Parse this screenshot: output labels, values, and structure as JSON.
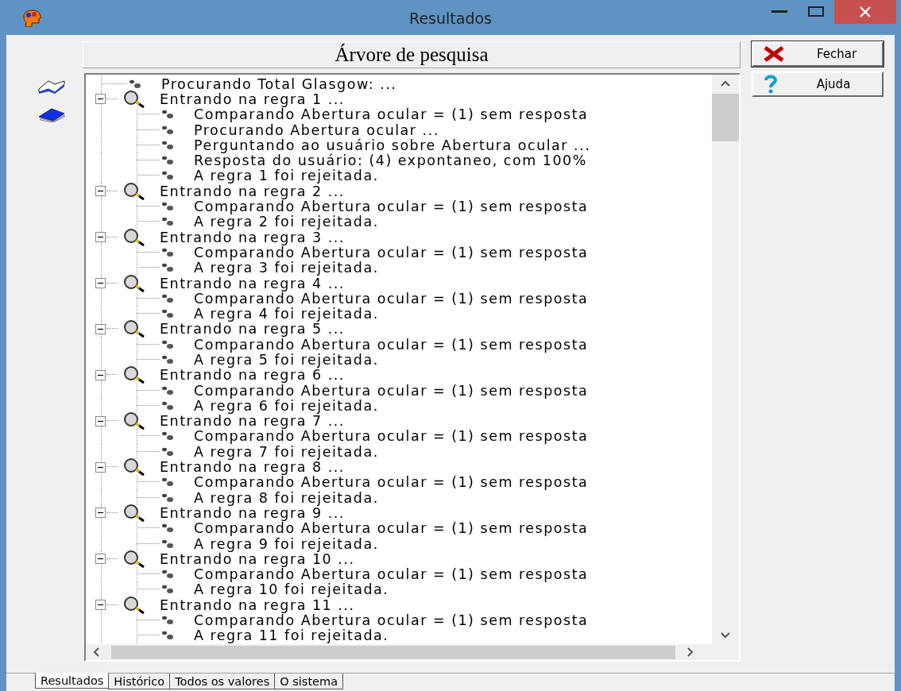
{
  "window": {
    "title": "Resultados"
  },
  "header": "Árvore de pesquisa",
  "buttons": [
    {
      "kind": "close",
      "label": "Fechar"
    },
    {
      "kind": "help",
      "label": "Ajuda"
    }
  ],
  "tree": [
    {
      "kind": "step",
      "label": "Procurando Total Glasgow: ..."
    },
    {
      "kind": "rule",
      "label": "Entrando na regra 1 ...",
      "expanded": true,
      "children": [
        {
          "label": "Comparando Abertura ocular = (1) sem resposta"
        },
        {
          "label": "Procurando Abertura ocular ..."
        },
        {
          "label": "Perguntando ao usuário sobre Abertura ocular ..."
        },
        {
          "label": "Resposta do usuário: (4) expontaneo, com 100%"
        },
        {
          "label": "A regra 1 foi rejeitada."
        }
      ]
    },
    {
      "kind": "rule",
      "label": "Entrando na regra 2 ...",
      "expanded": true,
      "children": [
        {
          "label": "Comparando Abertura ocular = (1) sem resposta"
        },
        {
          "label": "A regra 2 foi rejeitada."
        }
      ]
    },
    {
      "kind": "rule",
      "label": "Entrando na regra 3 ...",
      "expanded": true,
      "children": [
        {
          "label": "Comparando Abertura ocular = (1) sem resposta"
        },
        {
          "label": "A regra 3 foi rejeitada."
        }
      ]
    },
    {
      "kind": "rule",
      "label": "Entrando na regra 4 ...",
      "expanded": true,
      "children": [
        {
          "label": "Comparando Abertura ocular = (1) sem resposta"
        },
        {
          "label": "A regra 4 foi rejeitada."
        }
      ]
    },
    {
      "kind": "rule",
      "label": "Entrando na regra 5 ...",
      "expanded": true,
      "children": [
        {
          "label": "Comparando Abertura ocular = (1) sem resposta"
        },
        {
          "label": "A regra 5 foi rejeitada."
        }
      ]
    },
    {
      "kind": "rule",
      "label": "Entrando na regra 6 ...",
      "expanded": true,
      "children": [
        {
          "label": "Comparando Abertura ocular = (1) sem resposta"
        },
        {
          "label": "A regra 6 foi rejeitada."
        }
      ]
    },
    {
      "kind": "rule",
      "label": "Entrando na regra 7 ...",
      "expanded": true,
      "children": [
        {
          "label": "Comparando Abertura ocular = (1) sem resposta"
        },
        {
          "label": "A regra 7 foi rejeitada."
        }
      ]
    },
    {
      "kind": "rule",
      "label": "Entrando na regra 8 ...",
      "expanded": true,
      "children": [
        {
          "label": "Comparando Abertura ocular = (1) sem resposta"
        },
        {
          "label": "A regra 8 foi rejeitada."
        }
      ]
    },
    {
      "kind": "rule",
      "label": "Entrando na regra 9 ...",
      "expanded": true,
      "children": [
        {
          "label": "Comparando Abertura ocular = (1) sem resposta"
        },
        {
          "label": "A regra 9 foi rejeitada."
        }
      ]
    },
    {
      "kind": "rule",
      "label": "Entrando na regra 10 ...",
      "expanded": true,
      "children": [
        {
          "label": "Comparando Abertura ocular = (1) sem resposta"
        },
        {
          "label": "A regra 10 foi rejeitada."
        }
      ]
    },
    {
      "kind": "rule",
      "label": "Entrando na regra 11 ...",
      "expanded": true,
      "children": [
        {
          "label": "Comparando Abertura ocular = (1) sem resposta"
        },
        {
          "label": "A regra 11 foi rejeitada."
        }
      ]
    }
  ],
  "tabs": [
    {
      "label": "Resultados",
      "selected": true
    },
    {
      "label": "Histórico",
      "selected": false
    },
    {
      "label": "Todos os valores",
      "selected": false
    },
    {
      "label": "O sistema",
      "selected": false
    }
  ]
}
